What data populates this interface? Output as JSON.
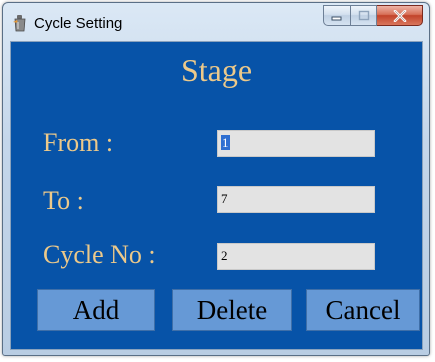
{
  "window": {
    "title": "Cycle Setting",
    "title_icon": "app-icon",
    "controls": [
      "minimize-icon",
      "maximize-icon",
      "close-icon"
    ]
  },
  "form": {
    "heading": "Stage",
    "from_label": "From :",
    "from_value": "1",
    "to_label": "To :",
    "to_value": "7",
    "cycle_label": "Cycle No :",
    "cycle_value": "2"
  },
  "buttons": {
    "add": "Add",
    "delete": "Delete",
    "cancel": "Cancel"
  },
  "colors": {
    "client_background": "#0753A8",
    "label_text": "#ECC98A",
    "button_face": "#6699D6",
    "input_background": "#E3E3E3",
    "close_button": "#C2432A"
  }
}
